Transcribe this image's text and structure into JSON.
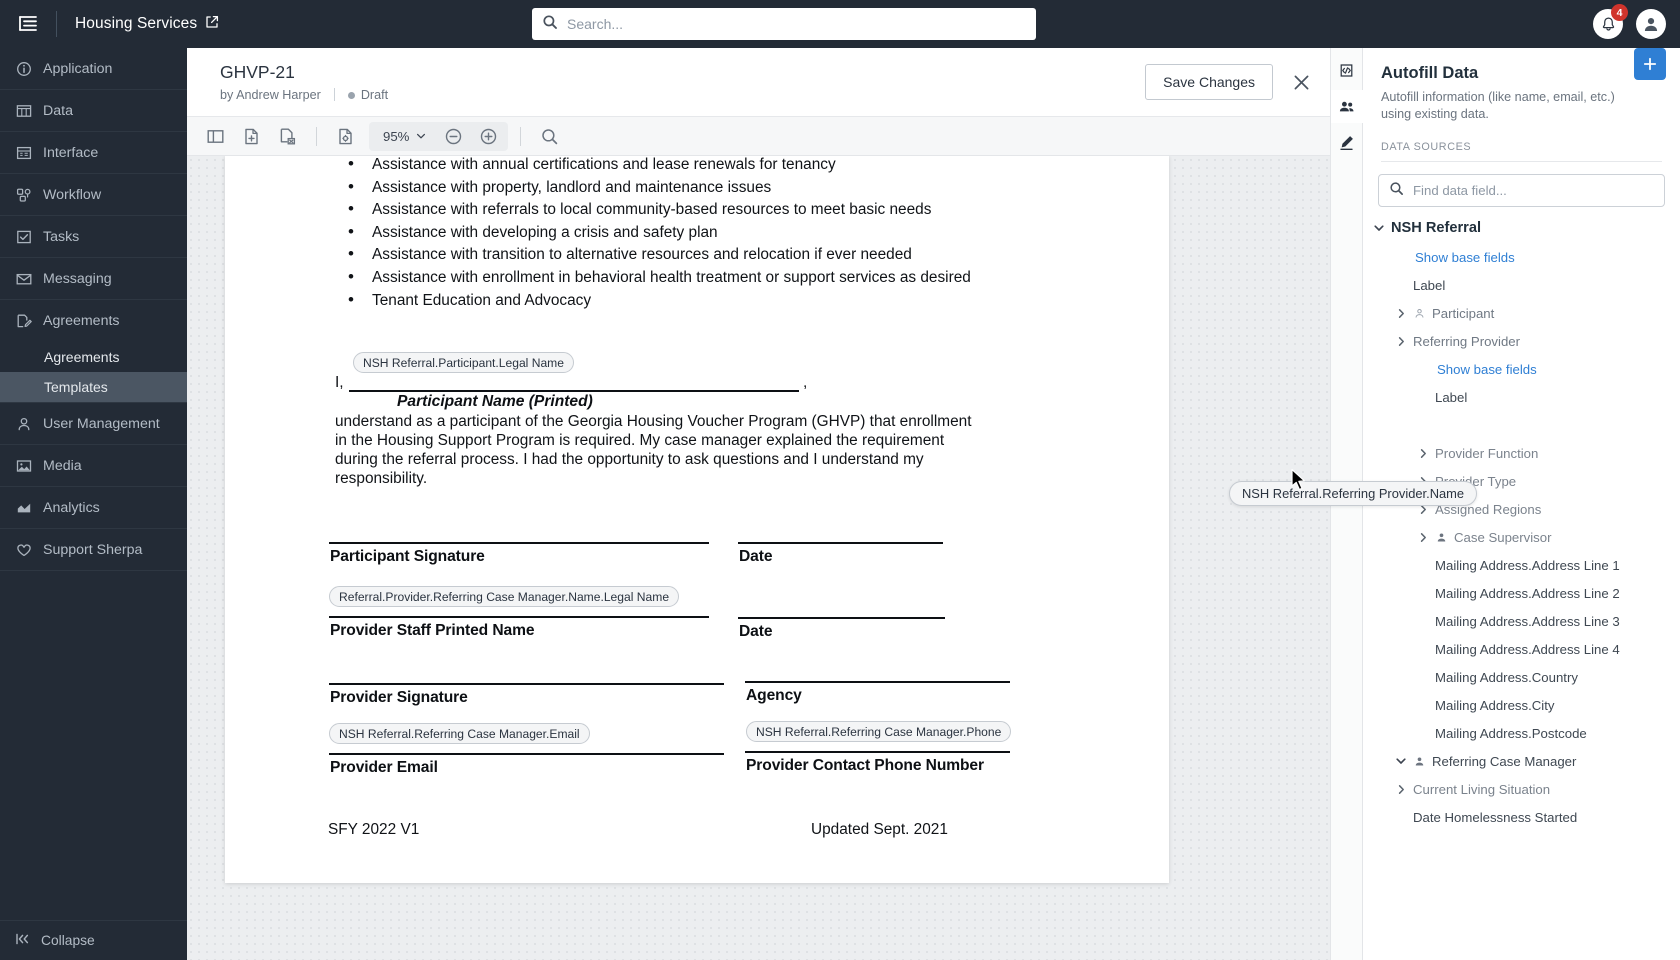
{
  "topbar": {
    "menu_icon": "hamburger-menu-icon",
    "brand": "Housing Services",
    "brand_external_icon": "external-link-icon",
    "search_placeholder": "Search...",
    "search_value": "",
    "search_icon": "search-icon",
    "notifications_icon": "bell-icon",
    "notifications_count": "4",
    "avatar_icon": "user-avatar-icon",
    "badge_color": "#d0342c"
  },
  "sidebar": {
    "items": [
      {
        "label": "Application",
        "icon": "info-circle-icon"
      },
      {
        "label": "Data",
        "icon": "table-icon"
      },
      {
        "label": "Interface",
        "icon": "layout-icon"
      },
      {
        "label": "Workflow",
        "icon": "workflow-icon"
      },
      {
        "label": "Tasks",
        "icon": "checkbox-icon"
      },
      {
        "label": "Messaging",
        "icon": "envelope-icon"
      }
    ],
    "group": {
      "label": "Agreements",
      "icon": "document-edit-icon",
      "children": [
        {
          "label": "Agreements",
          "active": false
        },
        {
          "label": "Templates",
          "active": true
        }
      ]
    },
    "items_after": [
      {
        "label": "User Management",
        "icon": "person-icon"
      },
      {
        "label": "Media",
        "icon": "image-icon"
      },
      {
        "label": "Analytics",
        "icon": "chart-icon"
      },
      {
        "label": "Support Sherpa",
        "icon": "heart-icon"
      }
    ],
    "collapse": {
      "label": "Collapse",
      "icon": "collapse-icon"
    }
  },
  "doc_header": {
    "title": "GHVP-21",
    "author": "by Andrew Harper",
    "status": "Draft",
    "save_label": "Save Changes",
    "close_icon": "close-icon"
  },
  "toolbar": {
    "sidebar_toggle_icon": "panel-toggle-icon",
    "add_page_icon": "add-page-icon",
    "delete_page_icon": "delete-page-icon",
    "page_settings_icon": "page-settings-icon",
    "zoom_level": "95%",
    "zoom_caret_icon": "chevron-down-icon",
    "zoom_out_icon": "zoom-out-icon",
    "zoom_in_icon": "zoom-in-icon",
    "find_icon": "search-icon"
  },
  "document": {
    "bullets": [
      "Assistance with annual certifications and lease renewals for tenancy",
      "Assistance with property, landlord and maintenance issues",
      "Assistance with referrals to local community-based resources to meet basic needs",
      "Assistance with developing a crisis and safety plan",
      "Assistance with transition to alternative resources and relocation if ever needed",
      "Assistance with enrollment in behavioral health treatment or support services as desired",
      "Tenant Education and Advocacy"
    ],
    "i_prefix": "I,",
    "comma_suffix": ",",
    "participant_chip": "NSH Referral.Participant.Legal Name",
    "participant_caption": "Participant Name (Printed)",
    "paragraph": "understand as a participant of the Georgia Housing Voucher Program (GHVP) that enrollment in the Housing Support Program is required. My case manager explained the requirement during the referral process. I had the opportunity to ask questions and I understand my responsibility.",
    "participant_signature_label": "Participant Signature",
    "date_label_1": "Date",
    "provider_name_chip": "Referral.Provider.Referring Case Manager.Name.Legal Name",
    "provider_staff_label": "Provider Staff Printed Name",
    "date_label_2": "Date",
    "provider_signature_label": "Provider Signature",
    "agency_label": "Agency",
    "provider_email_chip": "NSH Referral.Referring Case Manager.Email",
    "provider_email_label": "Provider Email",
    "provider_phone_chip": "NSH Referral.Referring Case Manager.Phone",
    "provider_phone_label": "Provider Contact Phone Number",
    "footer_left": "SFY 2022 V1",
    "footer_right": "Updated Sept. 2021"
  },
  "right_panel": {
    "tabs": [
      {
        "icon": "code-icon",
        "active": false
      },
      {
        "icon": "people-icon",
        "active": true
      },
      {
        "icon": "pen-icon",
        "active": false
      }
    ],
    "title": "Autofill Data",
    "description": "Autofill information (like name, email, etc.) using existing data.",
    "add_icon": "plus-icon",
    "accent": "#2f7fd4",
    "section_label": "DATA SOURCES",
    "find_placeholder": "Find data field...",
    "find_value": "",
    "find_icon": "search-icon",
    "tree": [
      {
        "label": "NSH Referral",
        "kind": "root",
        "caret": "down",
        "indent": 0
      },
      {
        "label": "Show base fields",
        "kind": "link",
        "indent": 1
      },
      {
        "label": "Label",
        "kind": "plain",
        "indent": 1
      },
      {
        "label": "Participant",
        "kind": "muted",
        "caret": "right",
        "person": true,
        "indent": 1
      },
      {
        "label": "Referring Provider",
        "kind": "muted",
        "caret": "right",
        "indent": 1
      },
      {
        "label": "Show base fields",
        "kind": "link",
        "indent": 2
      },
      {
        "label": "Label",
        "kind": "plain",
        "indent": 2
      },
      {
        "label": "__DRAG_PLACEHOLDER__",
        "kind": "spacer",
        "indent": 2
      },
      {
        "label": "Provider Function",
        "kind": "grey",
        "caret": "right",
        "indent": 2
      },
      {
        "label": "Provider Type",
        "kind": "grey",
        "caret": "right",
        "indent": 2
      },
      {
        "label": "Assigned Regions",
        "kind": "grey",
        "caret": "right",
        "indent": 2
      },
      {
        "label": "Case Supervisor",
        "kind": "grey",
        "caret": "right",
        "person": true,
        "indent": 2
      },
      {
        "label": "Mailing Address.Address Line 1",
        "kind": "plain",
        "indent": 2
      },
      {
        "label": "Mailing Address.Address Line 2",
        "kind": "plain",
        "indent": 2
      },
      {
        "label": "Mailing Address.Address Line 3",
        "kind": "plain",
        "indent": 2
      },
      {
        "label": "Mailing Address.Address Line 4",
        "kind": "plain",
        "indent": 2
      },
      {
        "label": "Mailing Address.Country",
        "kind": "plain",
        "indent": 2
      },
      {
        "label": "Mailing Address.City",
        "kind": "plain",
        "indent": 2
      },
      {
        "label": "Mailing Address.Postcode",
        "kind": "plain",
        "indent": 2
      },
      {
        "label": "Referring Case Manager",
        "kind": "plain",
        "caret": "down",
        "person": true,
        "indent": 1
      },
      {
        "label": "Current Living Situation",
        "kind": "grey",
        "caret": "right",
        "indent": 1
      },
      {
        "label": "Date Homelessness Started",
        "kind": "plain",
        "indent": 1
      }
    ],
    "dragging_chip": "NSH Referral.Referring Provider.Name"
  }
}
